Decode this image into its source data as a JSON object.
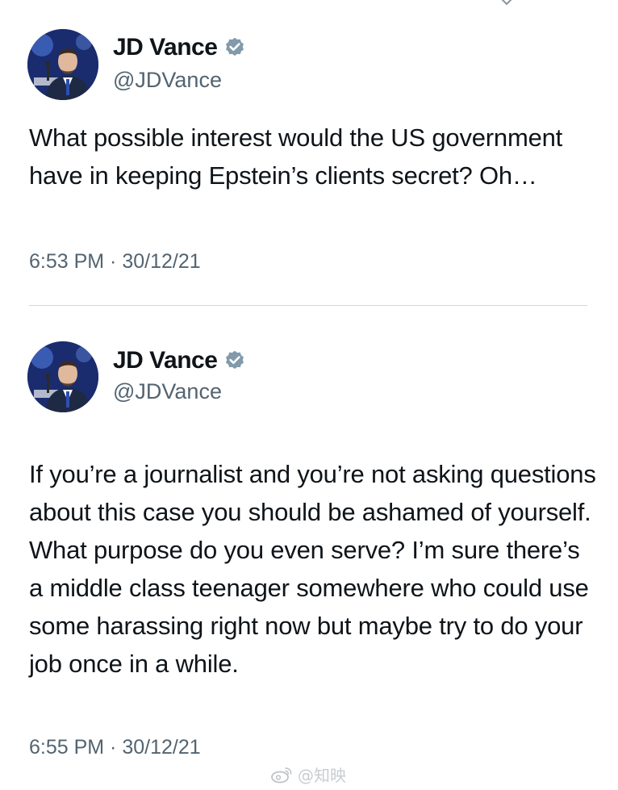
{
  "tweets": [
    {
      "author": {
        "display_name": "JD Vance",
        "handle": "@JDVance",
        "verified": true,
        "avatar_icon": "person-avatar"
      },
      "text": "What possible interest would the US government have in keeping Epstein’s clients secret? Oh…",
      "timestamp": "6:53 PM · 30/12/21"
    },
    {
      "author": {
        "display_name": "JD Vance",
        "handle": "@JDVance",
        "verified": true,
        "avatar_icon": "person-avatar"
      },
      "text": "If you’re a journalist and you’re not asking questions about this case you should be ashamed of yourself. What purpose do you even serve? I’m sure there’s a middle class teenager somewhere who could use some harassing right now but maybe try to do your job once in a while.",
      "timestamp": "6:55 PM · 30/12/21"
    }
  ],
  "watermark": {
    "icon": "weibo-icon",
    "text": "@知映"
  },
  "colors": {
    "text_primary": "#0f1419",
    "text_secondary": "#536471",
    "verified_badge": "#829aab",
    "divider": "#cfd9de"
  }
}
